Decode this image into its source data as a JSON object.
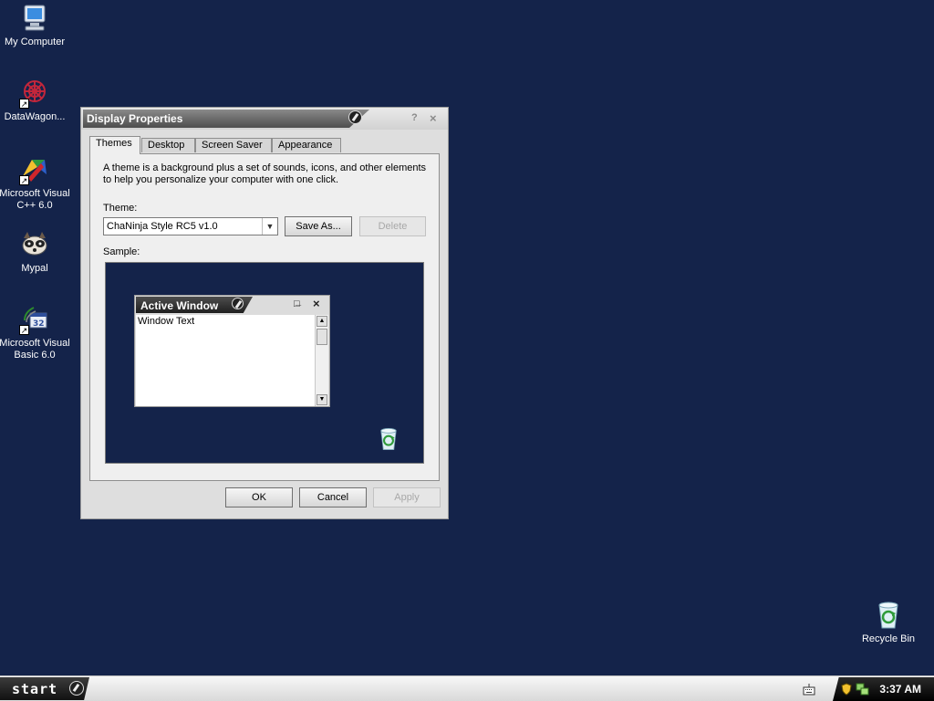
{
  "desktop": {
    "icons": [
      {
        "label": "My Computer"
      },
      {
        "label": "DataWagon..."
      },
      {
        "label": "Microsoft Visual C++ 6.0"
      },
      {
        "label": "Mypal"
      },
      {
        "label": "Microsoft Visual Basic 6.0"
      },
      {
        "label": "Recycle Bin"
      }
    ]
  },
  "dialog": {
    "title": "Display Properties",
    "help_glyph": "?",
    "close_glyph": "×",
    "tabs": [
      {
        "label": "Themes",
        "active": true
      },
      {
        "label": "Desktop"
      },
      {
        "label": "Screen Saver"
      },
      {
        "label": "Appearance"
      }
    ],
    "description": "A theme is a background plus a set of sounds, icons, and other elements to help you personalize your computer with one click.",
    "theme_label": "Theme:",
    "theme_value": "ChaNinja Style RC5 v1.0",
    "save_as_label": "Save As...",
    "delete_label": "Delete",
    "sample_label": "Sample:",
    "sample_window": {
      "title": "Active Window",
      "minimize": "_",
      "maximize": "□",
      "close": "×",
      "body_text": "Window Text"
    },
    "ok_label": "OK",
    "cancel_label": "Cancel",
    "apply_label": "Apply"
  },
  "taskbar": {
    "start_label": "start",
    "clock": "3:37 AM"
  },
  "colors": {
    "desktop_background": "#14234a",
    "dialog_face": "#dedede"
  }
}
